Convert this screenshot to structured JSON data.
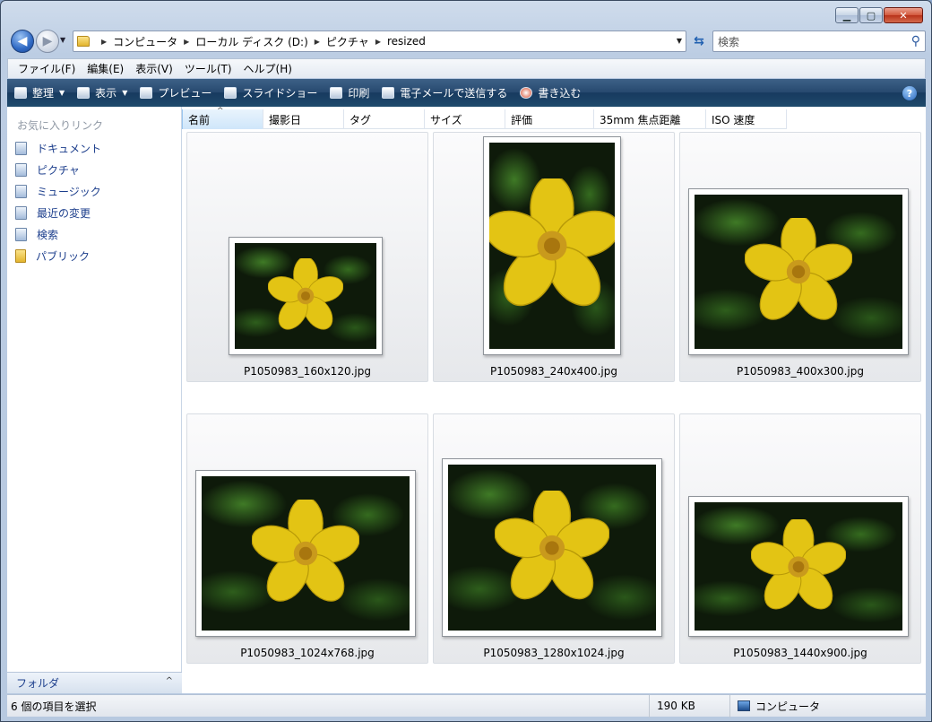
{
  "window": {
    "minimize_icon": "minimize-icon",
    "maximize_icon": "maximize-icon",
    "close_icon": "close-icon"
  },
  "address": {
    "crumbs": [
      "コンピュータ",
      "ローカル ディスク (D:)",
      "ピクチャ",
      "resized"
    ],
    "search_placeholder": "検索"
  },
  "menu": {
    "items": [
      "ファイル(F)",
      "編集(E)",
      "表示(V)",
      "ツール(T)",
      "ヘルプ(H)"
    ]
  },
  "commands": {
    "items": [
      "整理",
      "表示",
      "プレビュー",
      "スライドショー",
      "印刷",
      "電子メールで送信する",
      "書き込む"
    ]
  },
  "nav_pane": {
    "header": "お気に入りリンク",
    "items": [
      "ドキュメント",
      "ピクチャ",
      "ミュージック",
      "最近の変更",
      "検索",
      "パブリック"
    ],
    "folders_label": "フォルダ"
  },
  "columns": [
    "名前",
    "撮影日",
    "タグ",
    "サイズ",
    "評価",
    "35mm 焦点距離",
    "ISO 速度"
  ],
  "files": [
    "P1050983_160x120.jpg",
    "P1050983_240x400.jpg",
    "P1050983_400x300.jpg",
    "P1050983_1024x768.jpg",
    "P1050983_1280x1024.jpg",
    "P1050983_1440x900.jpg"
  ],
  "status": {
    "selection": "6 個の項目を選択",
    "size": "190 KB",
    "zone": "コンピュータ"
  },
  "colors": {
    "command_bar": "#1f4a6c",
    "link_text": "#1c3e8c",
    "petal": "#e8c814"
  }
}
